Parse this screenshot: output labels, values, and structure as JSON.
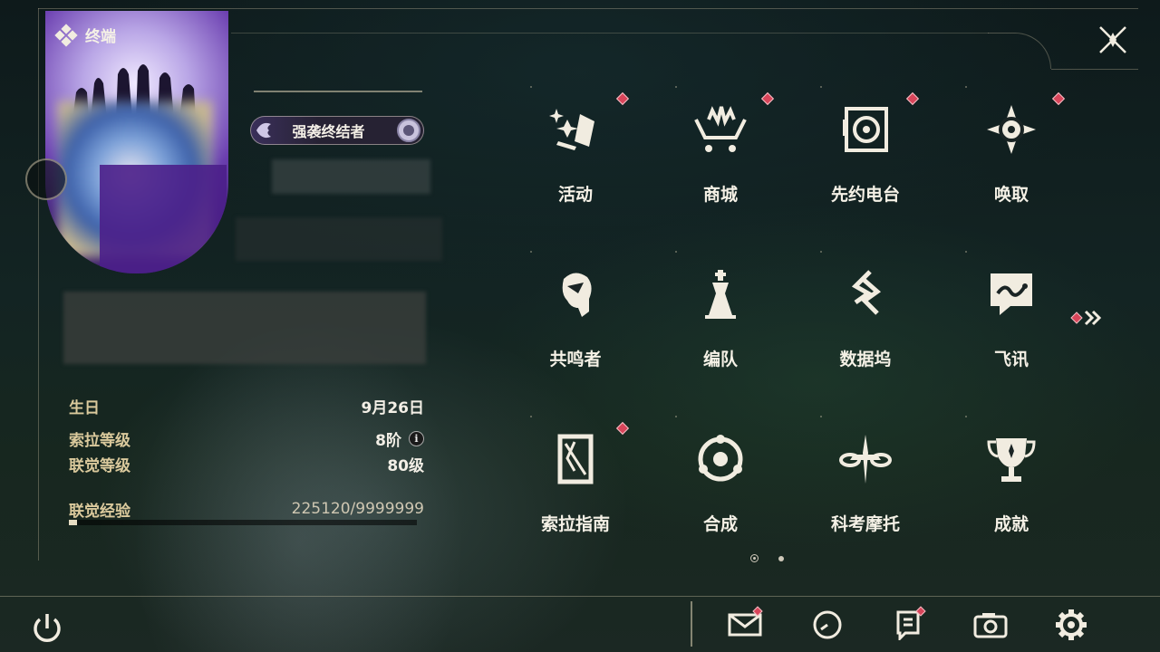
{
  "header": {
    "title": "终端"
  },
  "profile": {
    "title_badge": "强袭终结者",
    "stats": [
      {
        "label": "生日",
        "value": "9月26日"
      },
      {
        "label": "索拉等级",
        "value": "8阶"
      },
      {
        "label": "联觉等级",
        "value": "80级"
      },
      {
        "label": "联觉经验",
        "value": "225120/9999999"
      }
    ],
    "exp_fraction": 0.0225
  },
  "menu": {
    "items": [
      {
        "label": "活动",
        "icon": "activity-icon",
        "badge": true
      },
      {
        "label": "商城",
        "icon": "shop-cart-icon",
        "badge": true
      },
      {
        "label": "先约电台",
        "icon": "radio-icon",
        "badge": true
      },
      {
        "label": "唤取",
        "icon": "compass-star-icon",
        "badge": true
      },
      {
        "label": "共鸣者",
        "icon": "character-head-icon",
        "badge": false
      },
      {
        "label": "编队",
        "icon": "chess-piece-icon",
        "badge": false
      },
      {
        "label": "数据坞",
        "icon": "data-dock-icon",
        "badge": false
      },
      {
        "label": "飞讯",
        "icon": "chat-bubble-icon",
        "badge": false
      },
      {
        "label": "索拉指南",
        "icon": "guide-book-icon",
        "badge": true
      },
      {
        "label": "合成",
        "icon": "synthesis-icon",
        "badge": false
      },
      {
        "label": "科考摩托",
        "icon": "motorbike-icon",
        "badge": false
      },
      {
        "label": "成就",
        "icon": "trophy-icon",
        "badge": false
      }
    ],
    "page_count": 2,
    "current_page": 1
  },
  "bottom_bar": {
    "buttons": [
      {
        "icon": "mail-icon",
        "badge": true
      },
      {
        "icon": "clock-icon",
        "badge": false
      },
      {
        "icon": "notice-icon",
        "badge": true
      },
      {
        "icon": "camera-icon",
        "badge": false
      },
      {
        "icon": "gear-icon",
        "badge": false
      }
    ]
  },
  "colors": {
    "badge": "#d8455a",
    "stat_label": "#dac99c",
    "text": "#f5f1e6"
  }
}
